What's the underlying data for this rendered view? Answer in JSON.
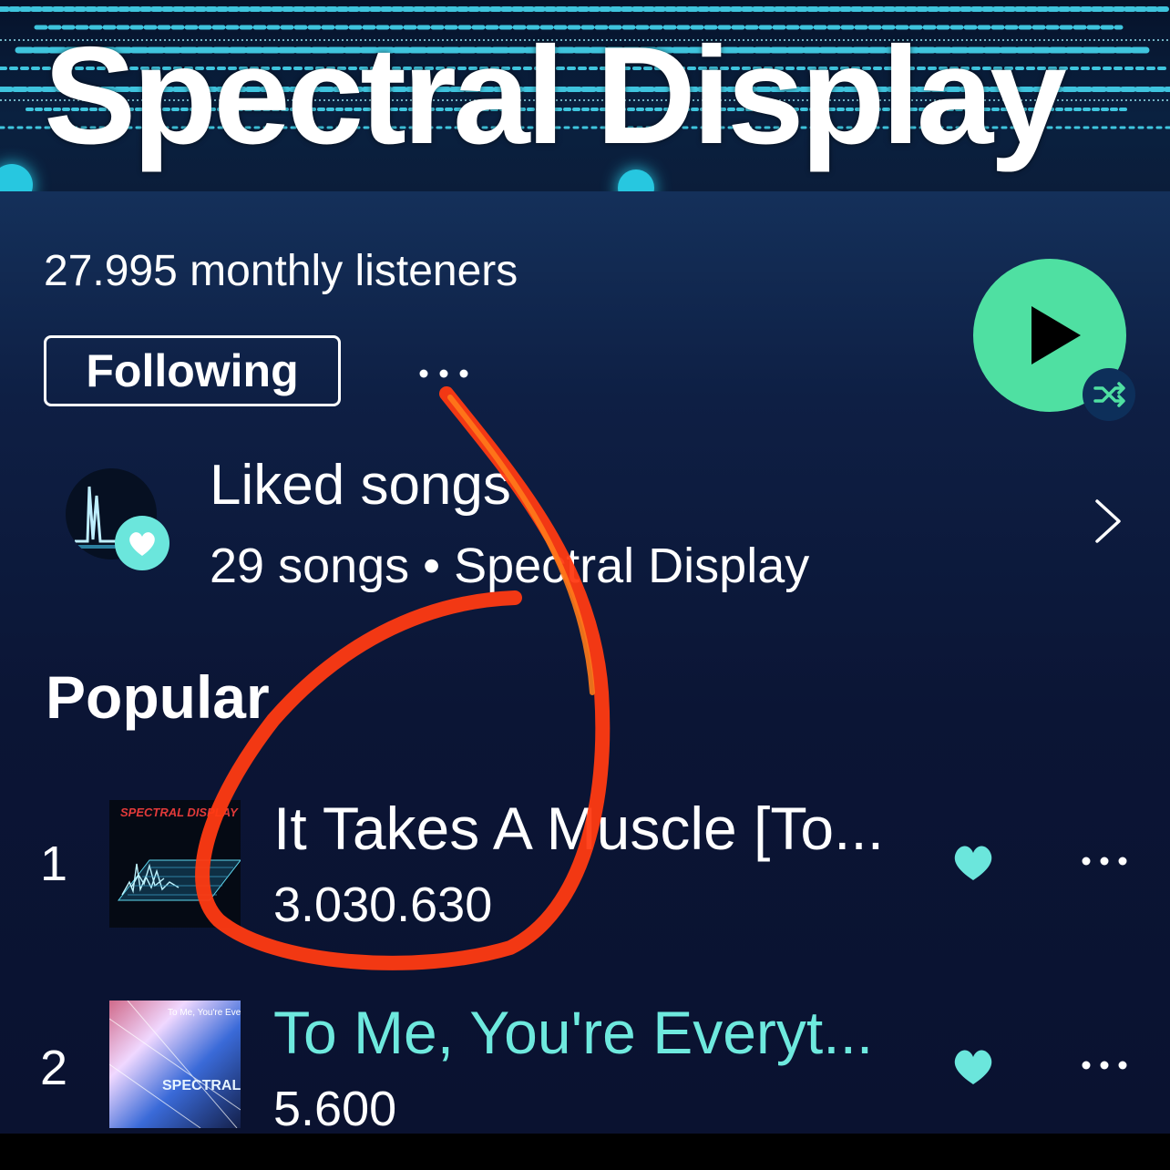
{
  "artist": {
    "name": "Spectral Display",
    "monthly_listeners": "27.995 monthly listeners"
  },
  "actions": {
    "follow_label": "Following",
    "more_icon": "more-horizontal-icon",
    "play_icon": "play-icon",
    "shuffle_icon": "shuffle-icon"
  },
  "liked": {
    "title": "Liked songs",
    "subtitle": "29 songs • Spectral Display"
  },
  "popular": {
    "heading": "Popular",
    "tracks": [
      {
        "rank": "1",
        "title": "It Takes A Muscle [To...",
        "plays": "3.030.630",
        "art_text": "SPECTRAL DISPLAY",
        "liked": true
      },
      {
        "rank": "2",
        "title": "To Me, You're Everyt...",
        "plays": "5.600",
        "art_text": "To Me, You're Everything",
        "art_text_2": "SPECTRAL",
        "liked": true
      }
    ]
  },
  "colors": {
    "accent_green": "#4fe0a2",
    "heart_teal": "#6be6dc",
    "playing_title": "#6ee9de",
    "annotation": "#ff3a12",
    "background": "#0c1636"
  }
}
